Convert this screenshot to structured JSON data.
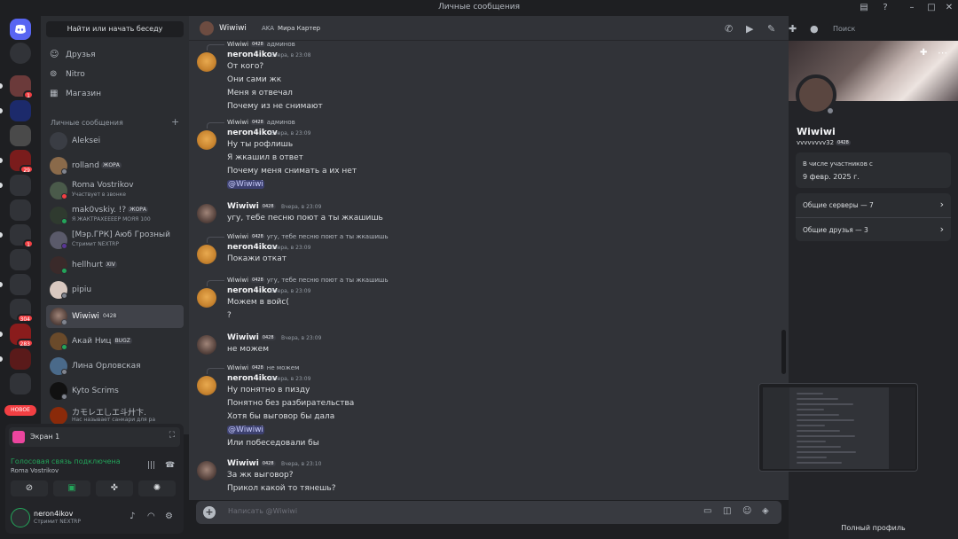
{
  "window": {
    "title": "Личные сообщения"
  },
  "rail": {
    "badges": [
      "1",
      "29",
      "1",
      "304",
      "283"
    ],
    "new_label": "НОВОЕ"
  },
  "sidebar": {
    "search_placeholder": "Найти или начать беседу",
    "nav": [
      {
        "label": "Друзья",
        "icon": "friends-icon"
      },
      {
        "label": "Nitro",
        "icon": "nitro-icon"
      },
      {
        "label": "Магазин",
        "icon": "shop-icon"
      }
    ],
    "dm_header": "Личные сообщения",
    "dms": [
      {
        "name": "Aleksei",
        "tag": "",
        "sub": ""
      },
      {
        "name": "rolland",
        "tag": "ЖОРА",
        "sub": ""
      },
      {
        "name": "Roma Vostrikov",
        "tag": "",
        "sub": "Участвует в звонке"
      },
      {
        "name": "mak0vskiy. !?",
        "tag": "ЖОРА",
        "sub": "Я ЖАКТРАХЕЕЕЕР МОЯЯ 100"
      },
      {
        "name": "[Мэр.ГРК] Аюб Грозный",
        "tag": "",
        "sub": "Стримит NEXTRP"
      },
      {
        "name": "hellhurt",
        "tag": "XIV",
        "sub": ""
      },
      {
        "name": "pipiu",
        "tag": "",
        "sub": ""
      },
      {
        "name": "Wiwiwi",
        "tag": "0428",
        "sub": ""
      },
      {
        "name": "Акай Ниц",
        "tag": "BUGZ",
        "sub": ""
      },
      {
        "name": "Лина Орловская",
        "tag": "",
        "sub": ""
      },
      {
        "name": "Kyto Scrims",
        "tag": "",
        "sub": ""
      },
      {
        "name": "カモレエ乚エ斗廾卞.",
        "tag": "",
        "sub": "Нас называет санкари для ра"
      }
    ]
  },
  "voice": {
    "screen_label": "Экран 1",
    "status": "Голосовая связь подключена",
    "channel": "Roma Vostrikov"
  },
  "user": {
    "name": "neron4ikov",
    "status": "Стримит NEXTRP"
  },
  "chat": {
    "header_name": "Wiwiwi",
    "aka_label": "AKA",
    "aka_name": "Мира Картер",
    "search_placeholder": "Поиск",
    "composer_placeholder": "Написать @Wiwiwi"
  },
  "messages": [
    {
      "reply_name": "Wiwiwi",
      "reply_text": "админов",
      "author": "neron4ikov",
      "time": "Вчера, в 23:08",
      "lines": [
        "От кого?",
        "Они сами жк",
        "Меня я отвечал",
        "Почему из не снимают"
      ]
    },
    {
      "reply_name": "Wiwiwi",
      "reply_text": "админов",
      "author": "neron4ikov",
      "time": "Вчера, в 23:09",
      "lines": [
        "Ну ты рофлишь",
        "Я жкашил в ответ",
        "Почему меня снимать а их нет",
        "@Wiwiwi"
      ]
    },
    {
      "author": "Wiwiwi",
      "time": "Вчера, в 23:09",
      "lines": [
        "угу, тебе песню поют а ты жкашишь"
      ]
    },
    {
      "reply_name": "Wiwiwi",
      "reply_text": "угу, тебе песню поют а ты жкашишь",
      "author": "neron4ikov",
      "time": "Вчера, в 23:09",
      "lines": [
        "Покажи откат"
      ]
    },
    {
      "reply_name": "Wiwiwi",
      "reply_text": "угу, тебе песню поют а ты жкашишь",
      "author": "neron4ikov",
      "time": "Вчера, в 23:09",
      "lines": [
        "Можем в войс(",
        "?"
      ]
    },
    {
      "author": "Wiwiwi",
      "time": "Вчера, в 23:09",
      "lines": [
        "не можем"
      ]
    },
    {
      "reply_name": "Wiwiwi",
      "reply_text": "не можем",
      "author": "neron4ikov",
      "time": "Вчера, в 23:09",
      "lines": [
        "Ну понятно в пизду",
        "Понятно без разбирательства",
        "Хотя бы выговор бы дала",
        "@Wiwiwi",
        "Или побеседовали бы"
      ]
    },
    {
      "author": "Wiwiwi",
      "time": "Вчера, в 23:10",
      "lines": [
        "За жк выговор?",
        "Прикол какой то тянешь?"
      ]
    }
  ],
  "badge_text": "0428",
  "profile": {
    "name": "Wiwiwi",
    "username": "vvvvvvvv32",
    "member_since_label": "В числе участников с",
    "member_since": "9 февр. 2025 г.",
    "mutual_servers": "Общие серверы — 7",
    "mutual_friends": "Общие друзья — 3",
    "full_profile": "Полный профиль"
  },
  "colors": {
    "accent": "#5865f2",
    "online": "#23a55a",
    "danger": "#f23f43"
  }
}
